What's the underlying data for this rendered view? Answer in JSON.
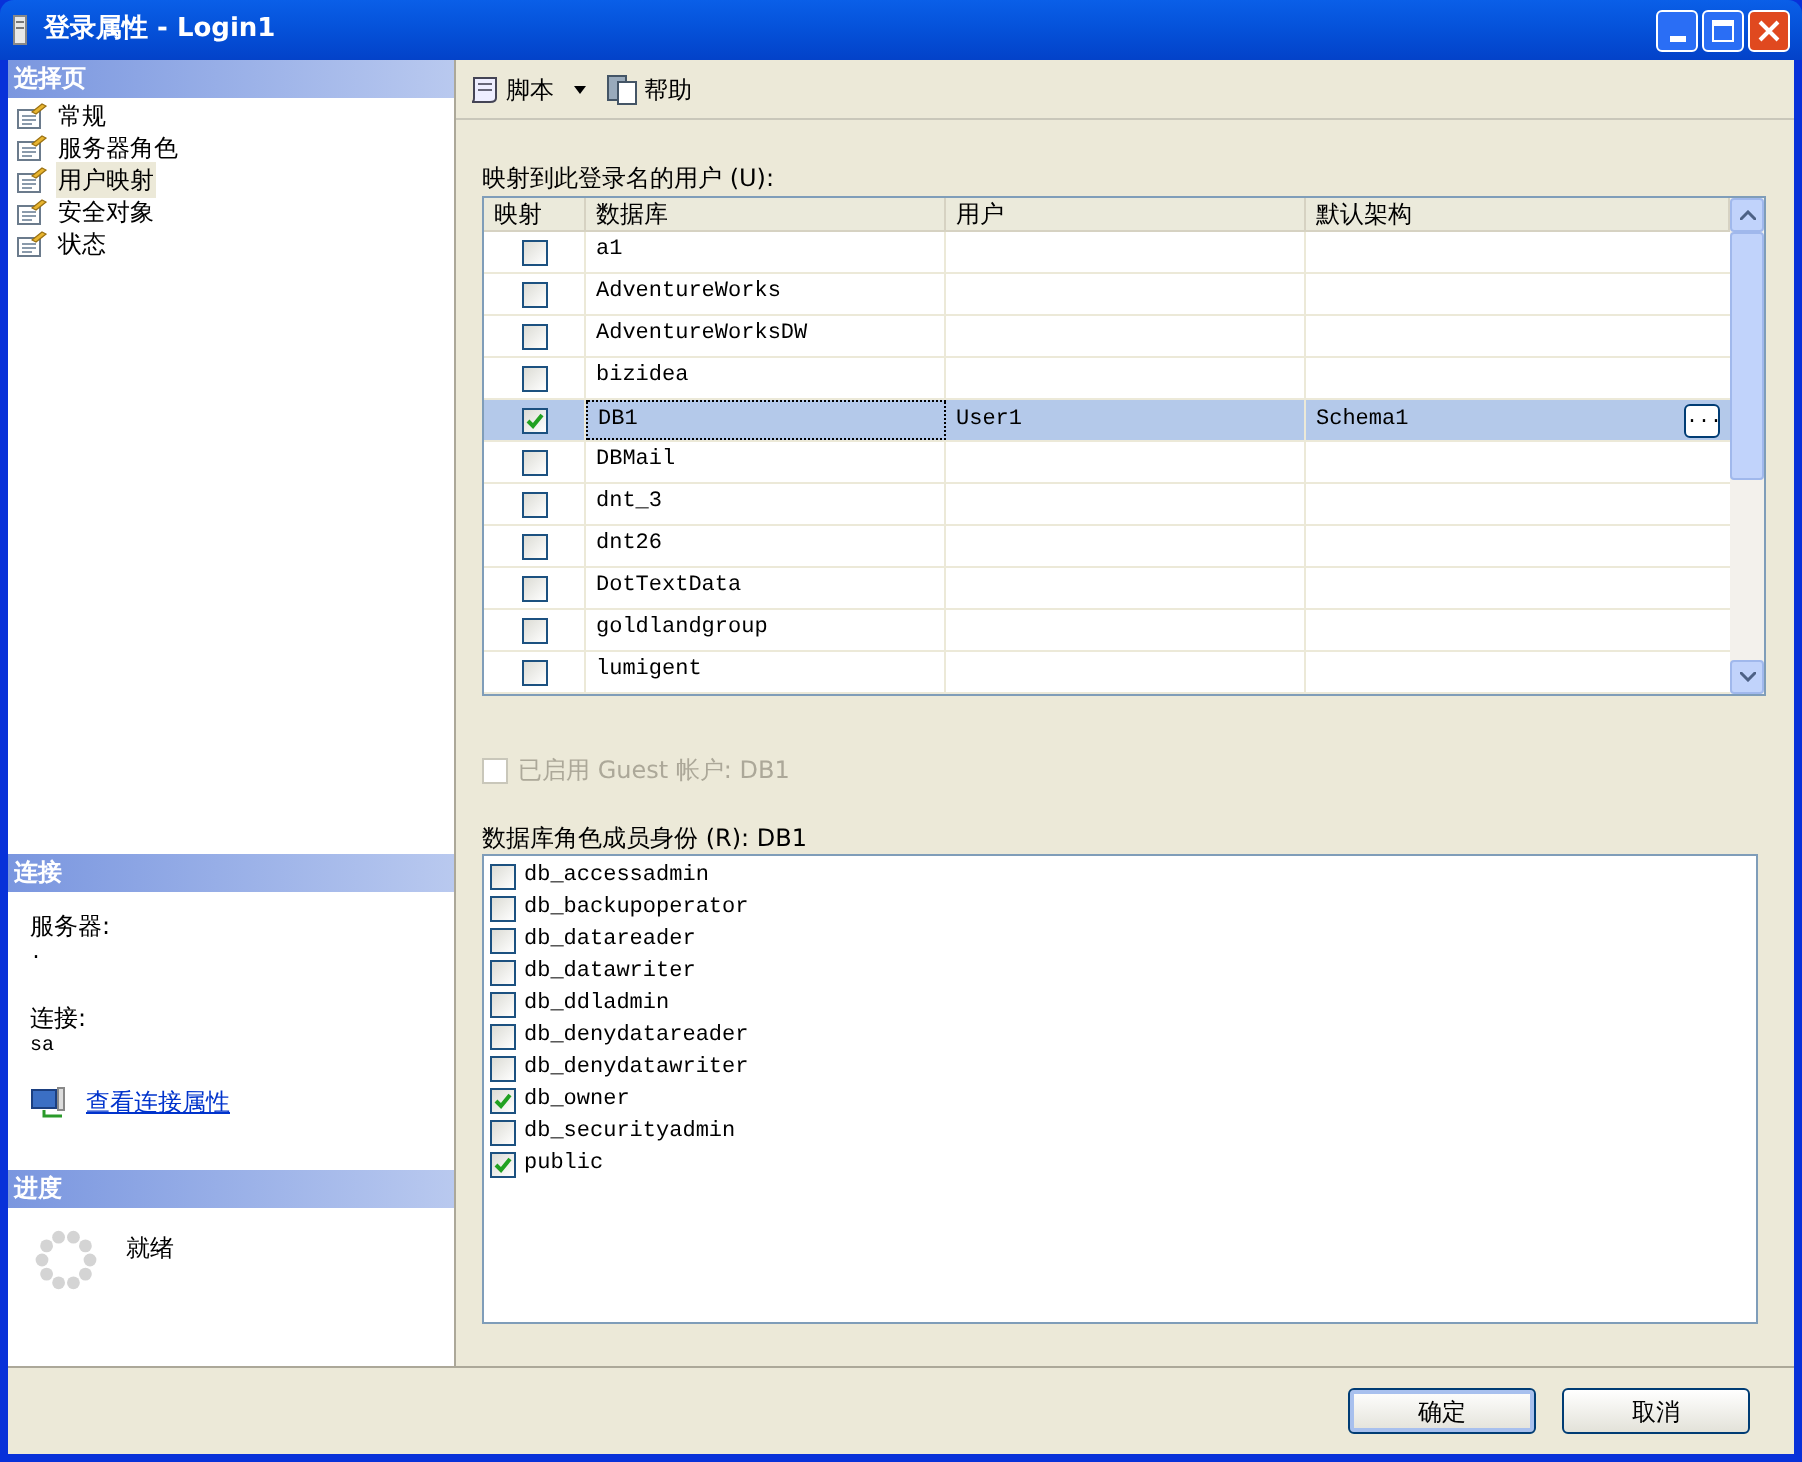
{
  "window": {
    "title": "登录属性 - Login1"
  },
  "sidebar": {
    "header": "选择页",
    "items": [
      {
        "label": "常规",
        "selected": false
      },
      {
        "label": "服务器角色",
        "selected": false
      },
      {
        "label": "用户映射",
        "selected": true
      },
      {
        "label": "安全对象",
        "selected": false
      },
      {
        "label": "状态",
        "selected": false
      }
    ]
  },
  "connection": {
    "header": "连接",
    "server_label": "服务器:",
    "server_value": ".",
    "connection_label": "连接:",
    "connection_value": "sa",
    "link": "查看连接属性"
  },
  "progress": {
    "header": "进度",
    "status": "就绪"
  },
  "toolbar": {
    "script": "脚本",
    "help": "帮助"
  },
  "mapping": {
    "label": "映射到此登录名的用户 (U):",
    "columns": [
      "映射",
      "数据库",
      "用户",
      "默认架构"
    ],
    "rows": [
      {
        "mapped": false,
        "selected": false,
        "database": "a1"
      },
      {
        "mapped": false,
        "selected": false,
        "database": "AdventureWorks"
      },
      {
        "mapped": false,
        "selected": false,
        "database": "AdventureWorksDW"
      },
      {
        "mapped": false,
        "selected": false,
        "database": "bizidea"
      },
      {
        "mapped": true,
        "selected": true,
        "database": "DB1",
        "user": "User1",
        "schema": "Schema1",
        "browse": "..."
      },
      {
        "mapped": false,
        "selected": false,
        "database": "DBMail"
      },
      {
        "mapped": false,
        "selected": false,
        "database": "dnt_3"
      },
      {
        "mapped": false,
        "selected": false,
        "database": "dnt26"
      },
      {
        "mapped": false,
        "selected": false,
        "database": "DotTextData"
      },
      {
        "mapped": false,
        "selected": false,
        "database": "goldlandgroup"
      },
      {
        "mapped": false,
        "selected": false,
        "database": "lumigent"
      }
    ]
  },
  "guest": {
    "label": "已启用 Guest 帐户: DB1",
    "checked": false,
    "disabled": true
  },
  "roles": {
    "label": "数据库角色成员身份 (R): DB1",
    "items": [
      {
        "name": "db_accessadmin",
        "checked": false
      },
      {
        "name": "db_backupoperator",
        "checked": false
      },
      {
        "name": "db_datareader",
        "checked": false
      },
      {
        "name": "db_datawriter",
        "checked": false
      },
      {
        "name": "db_ddladmin",
        "checked": false
      },
      {
        "name": "db_denydatareader",
        "checked": false
      },
      {
        "name": "db_denydatawriter",
        "checked": false
      },
      {
        "name": "db_owner",
        "checked": true
      },
      {
        "name": "db_securityadmin",
        "checked": false
      },
      {
        "name": "public",
        "checked": true
      }
    ]
  },
  "buttons": [
    "确定",
    "取消"
  ]
}
